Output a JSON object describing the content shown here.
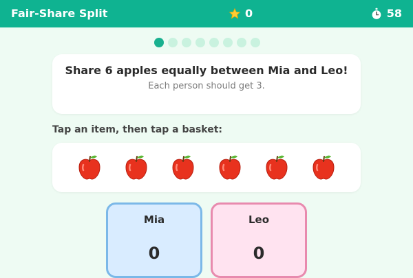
{
  "header": {
    "title": "Fair-Share Split",
    "score": "0",
    "score_icon": "star-icon",
    "timer": "58",
    "timer_icon": "stopwatch-icon"
  },
  "progress": {
    "total": 8,
    "current": 1
  },
  "prompt": {
    "title": "Share 6 apples equally between Mia and Leo!",
    "subtitle": "Each person should get 3."
  },
  "instruction": "Tap an item, then tap a basket:",
  "items": [
    {
      "icon": "apple-icon"
    },
    {
      "icon": "apple-icon"
    },
    {
      "icon": "apple-icon"
    },
    {
      "icon": "apple-icon"
    },
    {
      "icon": "apple-icon"
    },
    {
      "icon": "apple-icon"
    }
  ],
  "baskets": [
    {
      "name": "Mia",
      "count": "0"
    },
    {
      "name": "Leo",
      "count": "0"
    }
  ],
  "colors": {
    "header": "#0fb391",
    "background": "#eefbf3",
    "dot_active": "#19b08f",
    "dot_inactive": "#c9f2df",
    "mia_fill": "#d9ecff",
    "mia_border": "#7bb8e8",
    "leo_fill": "#ffe3f0",
    "leo_border": "#e88aae"
  }
}
